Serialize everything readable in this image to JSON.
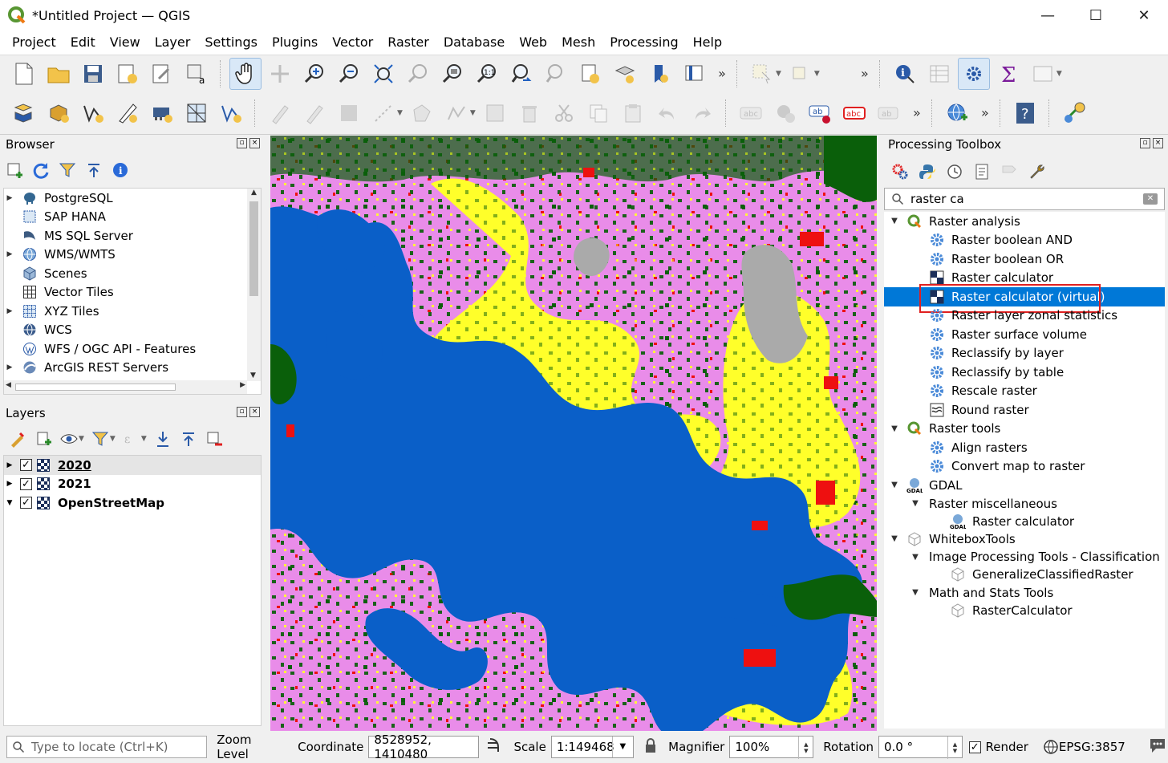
{
  "window": {
    "title": "*Untitled Project — QGIS",
    "minimize": "—",
    "maximize": "☐",
    "close": "✕"
  },
  "menubar": {
    "items": [
      "Project",
      "Edit",
      "View",
      "Layer",
      "Settings",
      "Plugins",
      "Vector",
      "Raster",
      "Database",
      "Web",
      "Mesh",
      "Processing",
      "Help"
    ]
  },
  "toolbar": {
    "more": "»"
  },
  "browser": {
    "title": "Browser",
    "items": [
      {
        "label": "PostgreSQL",
        "expandable": true,
        "icon": "postgresql-icon"
      },
      {
        "label": "SAP HANA",
        "expandable": false,
        "icon": "sap-hana-icon"
      },
      {
        "label": "MS SQL Server",
        "expandable": false,
        "icon": "mssql-icon"
      },
      {
        "label": "WMS/WMTS",
        "expandable": true,
        "icon": "globe-icon"
      },
      {
        "label": "Scenes",
        "expandable": false,
        "icon": "cube-icon"
      },
      {
        "label": "Vector Tiles",
        "expandable": false,
        "icon": "grid-icon"
      },
      {
        "label": "XYZ Tiles",
        "expandable": true,
        "icon": "dotted-grid-icon"
      },
      {
        "label": "WCS",
        "expandable": false,
        "icon": "globe-icon"
      },
      {
        "label": "WFS / OGC API - Features",
        "expandable": false,
        "icon": "wfs-icon"
      },
      {
        "label": "ArcGIS REST Servers",
        "expandable": true,
        "icon": "arcgis-icon"
      }
    ]
  },
  "layers": {
    "title": "Layers",
    "items": [
      {
        "label": "2020",
        "checked": true,
        "expanded": false
      },
      {
        "label": "2021",
        "checked": true,
        "expanded": false
      },
      {
        "label": "OpenStreetMap",
        "checked": true,
        "expanded": true
      }
    ]
  },
  "toolbox": {
    "title": "Processing Toolbox",
    "search_value": "raster ca",
    "rows": [
      {
        "label": "Raster analysis",
        "level": 0,
        "arrow": "▼",
        "icon": "qgis-icon"
      },
      {
        "label": "Raster boolean AND",
        "level": 1,
        "icon": "gear-icon"
      },
      {
        "label": "Raster boolean OR",
        "level": 1,
        "icon": "gear-icon"
      },
      {
        "label": "Raster calculator",
        "level": 1,
        "icon": "raster-calc-icon"
      },
      {
        "label": "Raster calculator (virtual)",
        "level": 1,
        "icon": "raster-calc-icon",
        "selected": true
      },
      {
        "label": "Raster layer zonal statistics",
        "level": 1,
        "icon": "gear-icon"
      },
      {
        "label": "Raster surface volume",
        "level": 1,
        "icon": "gear-icon"
      },
      {
        "label": "Reclassify by layer",
        "level": 1,
        "icon": "gear-icon"
      },
      {
        "label": "Reclassify by table",
        "level": 1,
        "icon": "gear-icon"
      },
      {
        "label": "Rescale raster",
        "level": 1,
        "icon": "gear-icon"
      },
      {
        "label": "Round raster",
        "level": 1,
        "icon": "round-icon"
      },
      {
        "label": "Raster tools",
        "level": 0,
        "arrow": "▼",
        "icon": "qgis-icon"
      },
      {
        "label": "Align rasters",
        "level": 1,
        "icon": "gear-icon"
      },
      {
        "label": "Convert map to raster",
        "level": 1,
        "icon": "gear-icon"
      },
      {
        "label": "GDAL",
        "level": 0,
        "arrow": "▼",
        "icon": "gdal-icon"
      },
      {
        "label": "Raster miscellaneous",
        "level": 1,
        "arrow": "▼",
        "icon": ""
      },
      {
        "label": "Raster calculator",
        "level": 2,
        "icon": "gdal-icon"
      },
      {
        "label": "WhiteboxTools",
        "level": 0,
        "arrow": "▼",
        "icon": "box-icon"
      },
      {
        "label": "Image Processing Tools - Classification",
        "level": 1,
        "arrow": "▼",
        "icon": ""
      },
      {
        "label": "GeneralizeClassifiedRaster",
        "level": 2,
        "icon": "box-icon"
      },
      {
        "label": "Math and Stats Tools",
        "level": 1,
        "arrow": "▼",
        "icon": ""
      },
      {
        "label": "RasterCalculator",
        "level": 2,
        "icon": "box-icon"
      }
    ]
  },
  "statusbar": {
    "locate_placeholder": "Type to locate (Ctrl+K)",
    "zoom_level_label": "Zoom Level",
    "coordinate_label": "Coordinate",
    "coordinate_value": "8528952, 1410480",
    "scale_label": "Scale",
    "scale_value": "1:149468",
    "magnifier_label": "Magnifier",
    "magnifier_value": "100%",
    "rotation_label": "Rotation",
    "rotation_value": "0.0 °",
    "render_label": "Render",
    "render_checked": true,
    "crs": "EPSG:3857"
  },
  "map_colors": {
    "water": "#0a5fc8",
    "urban": "#e98ce9",
    "crops": "#ffff2a",
    "trees": "#0a5f0a",
    "built": "#ee1010",
    "bare": "#aaaaaa"
  }
}
